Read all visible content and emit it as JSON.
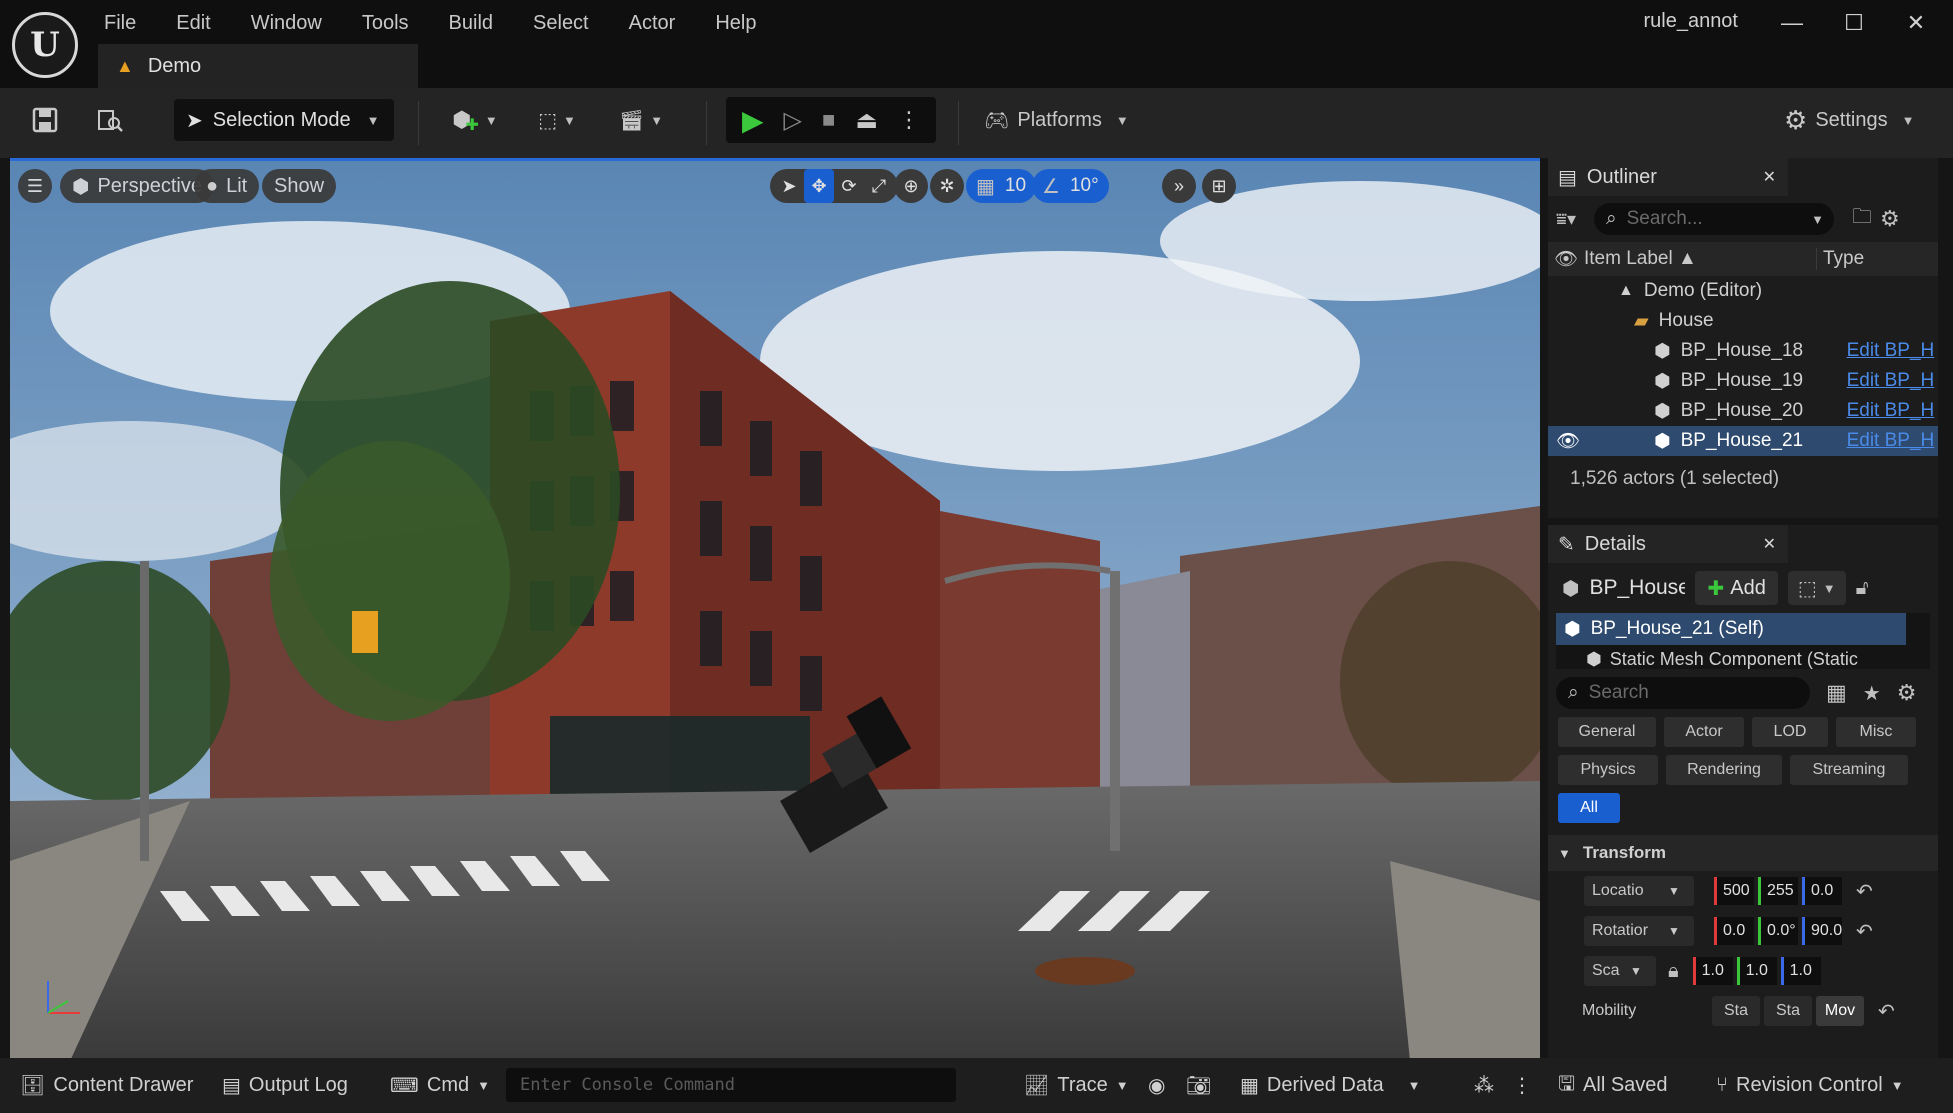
{
  "app": {
    "window_title": "rule_annot",
    "level_tab": "Demo"
  },
  "menu": [
    "File",
    "Edit",
    "Window",
    "Tools",
    "Build",
    "Select",
    "Actor",
    "Help"
  ],
  "toolbar": {
    "selection_mode": "Selection Mode",
    "platforms": "Platforms",
    "settings": "Settings"
  },
  "viewport": {
    "perspective": "Perspective",
    "lit": "Lit",
    "show": "Show",
    "grid_snap": "10",
    "angle_snap": "10°"
  },
  "outliner": {
    "title": "Outliner",
    "search_placeholder": "Search...",
    "col_label": "Item Label",
    "col_type": "Type",
    "rows": [
      {
        "label": "Demo (Editor)",
        "type": ""
      },
      {
        "label": "House",
        "type": ""
      },
      {
        "label": "BP_House_18",
        "type": "Edit BP_H"
      },
      {
        "label": "BP_House_19",
        "type": "Edit BP_H"
      },
      {
        "label": "BP_House_20",
        "type": "Edit BP_H"
      },
      {
        "label": "BP_House_21",
        "type": "Edit BP_H"
      }
    ],
    "status": "1,526 actors (1 selected)"
  },
  "details": {
    "title": "Details",
    "actor_name": "BP_House",
    "add_label": "Add",
    "components": [
      "BP_House_21 (Self)",
      "Static Mesh Component (Static"
    ],
    "search_placeholder": "Search",
    "categories": [
      "General",
      "Actor",
      "LOD",
      "Misc",
      "Physics",
      "Rendering",
      "Streaming",
      "All"
    ],
    "transform_header": "Transform",
    "location_label": "Locatio",
    "rotation_label": "Rotatior",
    "scale_label": "Sca",
    "location": [
      "500",
      "255",
      "0.0"
    ],
    "rotation": [
      "0.0",
      "0.0°",
      "90.0"
    ],
    "scale": [
      "1.0",
      "1.0",
      "1.0"
    ],
    "mobility_label": "Mobility",
    "mobility_options": [
      "Sta",
      "Sta",
      "Mov"
    ]
  },
  "statusbar": {
    "content_drawer": "Content Drawer",
    "output_log": "Output Log",
    "cmd": "Cmd",
    "console_placeholder": "Enter Console Command",
    "trace": "Trace",
    "derived_data": "Derived Data",
    "all_saved": "All Saved",
    "revision_control": "Revision Control"
  },
  "colors": {
    "accent_blue": "#1a5fd0",
    "link_blue": "#4a8ae8",
    "play_green": "#3cc83c",
    "selected_row": "#2e4a6e"
  }
}
